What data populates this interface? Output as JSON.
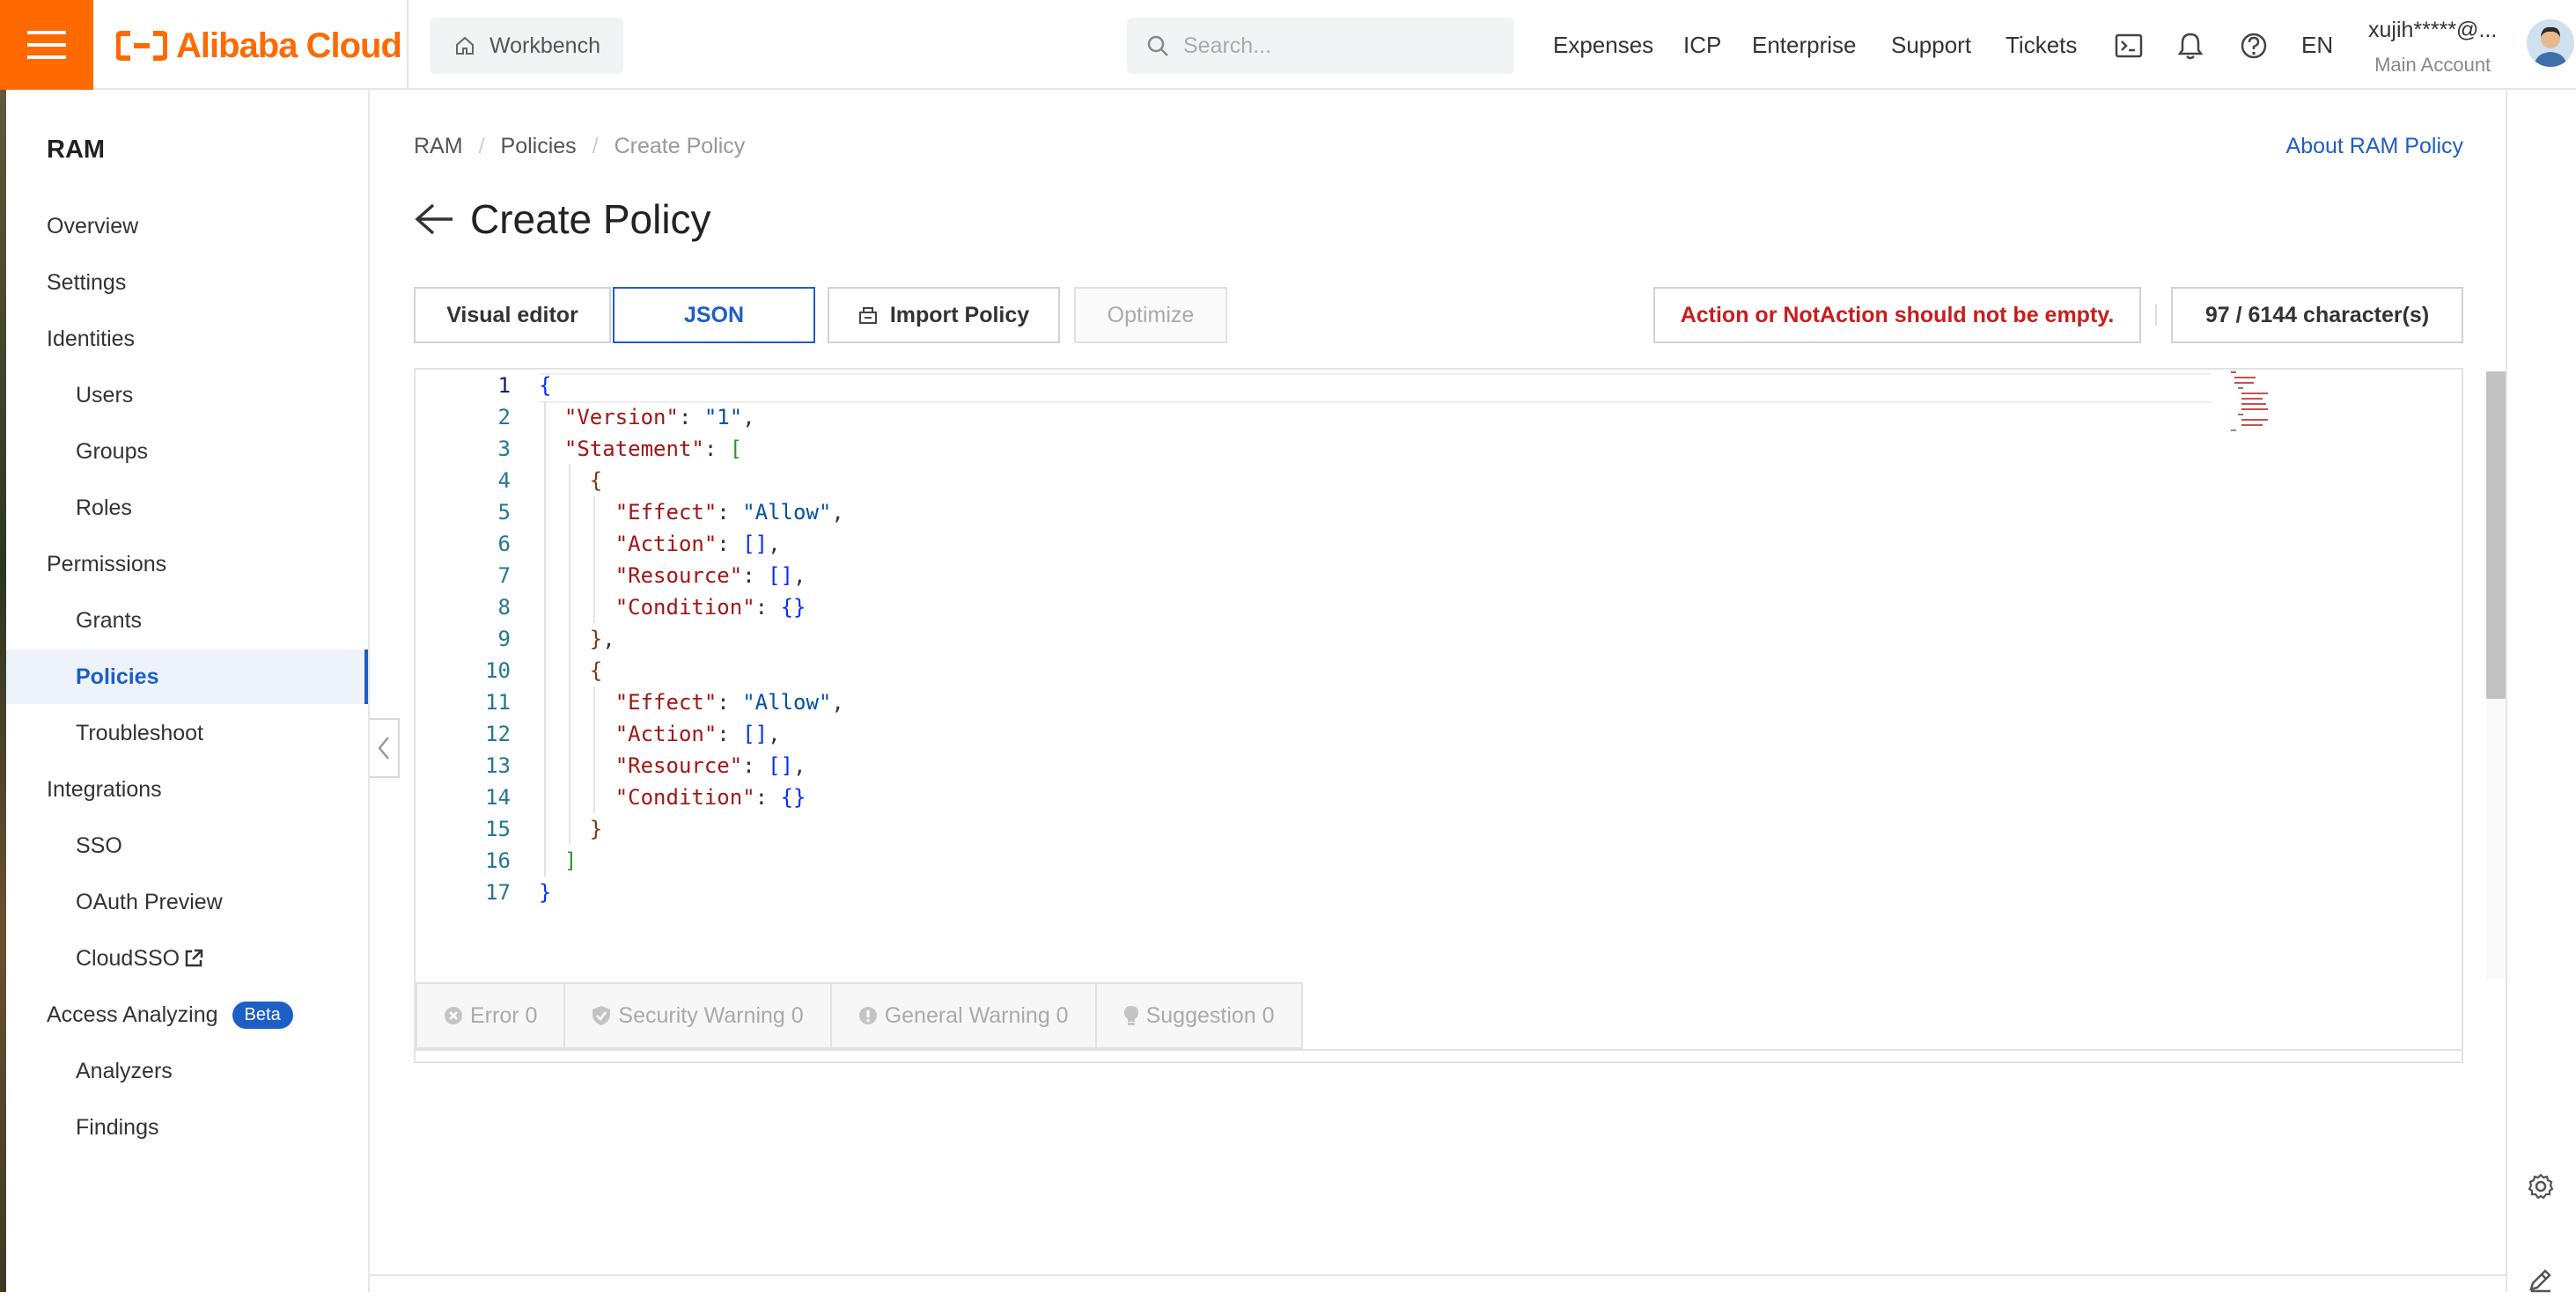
{
  "topbar": {
    "logo_text": "Alibaba Cloud",
    "workbench_label": "Workbench",
    "search_placeholder": "Search...",
    "nav": [
      "Expenses",
      "ICP",
      "Enterprise",
      "Support",
      "Tickets"
    ],
    "language": "EN",
    "account_name": "xujih*****@...",
    "account_type": "Main Account"
  },
  "sidebar": {
    "title": "RAM",
    "items": [
      {
        "label": "Overview"
      },
      {
        "label": "Settings"
      },
      {
        "label": "Identities"
      },
      {
        "label": "Users"
      },
      {
        "label": "Groups"
      },
      {
        "label": "Roles"
      },
      {
        "label": "Permissions"
      },
      {
        "label": "Grants"
      },
      {
        "label": "Policies"
      },
      {
        "label": "Troubleshoot"
      },
      {
        "label": "Integrations"
      },
      {
        "label": "SSO"
      },
      {
        "label": "OAuth Preview"
      },
      {
        "label": "CloudSSO"
      },
      {
        "label": "Access Analyzing"
      },
      {
        "label": "Analyzers"
      },
      {
        "label": "Findings"
      }
    ],
    "beta_badge": "Beta",
    "active_item": "Policies"
  },
  "main": {
    "breadcrumb": [
      "RAM",
      "Policies",
      "Create Policy"
    ],
    "about_link": "About RAM Policy",
    "page_title": "Create Policy",
    "tabs": {
      "visual_editor": "Visual editor",
      "json": "JSON"
    },
    "import_button": "Import Policy",
    "optimize_button": "Optimize",
    "error_message": "Action or NotAction should not be empty.",
    "char_count": "97 / 6144 character(s)"
  },
  "editor": {
    "current_line": 1,
    "line_numbers": [
      "1",
      "2",
      "3",
      "4",
      "5",
      "6",
      "7",
      "8",
      "9",
      "10",
      "11",
      "12",
      "13",
      "14",
      "15",
      "16",
      "17"
    ]
  },
  "problems": {
    "error": "Error 0",
    "security_warning": "Security Warning 0",
    "general_warning": "General Warning 0",
    "suggestion": "Suggestion 0"
  },
  "colors": {
    "brand_orange": "#ff6a00",
    "accent_blue": "#1d5ec7",
    "error_red": "#c81d1d"
  }
}
